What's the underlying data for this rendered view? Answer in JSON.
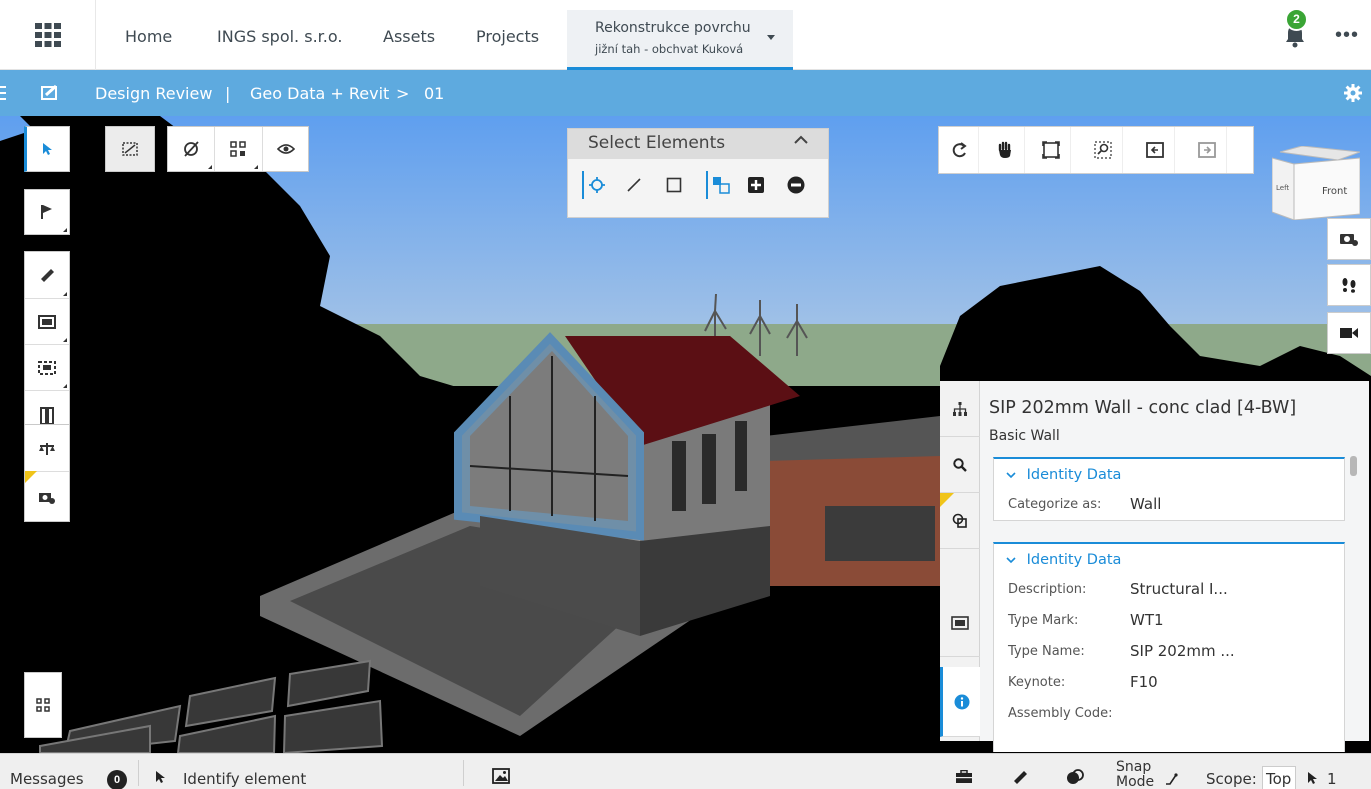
{
  "nav": {
    "links": [
      "Home",
      "INGS spol. s.r.o.",
      "Assets",
      "Projects"
    ],
    "project_title": "Rekonstrukce povrchu",
    "project_subtitle": "jižní tah - obchvat Kuková",
    "notification_count": "2",
    "more": "•••"
  },
  "breadcrumb": {
    "app": "Design Review",
    "separator": "|",
    "model": "Geo Data + Revit",
    "arrow": ">",
    "view": "01"
  },
  "select_panel": {
    "title": "Select Elements"
  },
  "viewcube": {
    "left": "Left",
    "front": "Front"
  },
  "properties": {
    "title": "SIP 202mm Wall - conc clad [4-BW]",
    "subtitle": "Basic Wall",
    "sections": [
      {
        "header": "Identity Data",
        "rows": [
          {
            "key": "Categorize as:",
            "value": "Wall"
          }
        ]
      },
      {
        "header": "Identity Data",
        "rows": [
          {
            "key": "Description:",
            "value": "Structural I..."
          },
          {
            "key": "Type Mark:",
            "value": "WT1"
          },
          {
            "key": "Type Name:",
            "value": "SIP 202mm ..."
          },
          {
            "key": "Keynote:",
            "value": "F10"
          },
          {
            "key": "Assembly Code:",
            "value": ""
          }
        ]
      }
    ]
  },
  "status": {
    "messages_label": "Messages",
    "messages_count": "0",
    "identify": "Identify element",
    "snap_mode": "Snap Mode",
    "scope_label": "Scope:",
    "scope_value": "Top",
    "selection_count": "1"
  },
  "colors": {
    "accent": "#1a8cd8",
    "bluebar": "#5eaadf",
    "badge": "#3aa535",
    "sky": "#6aa7ec"
  }
}
